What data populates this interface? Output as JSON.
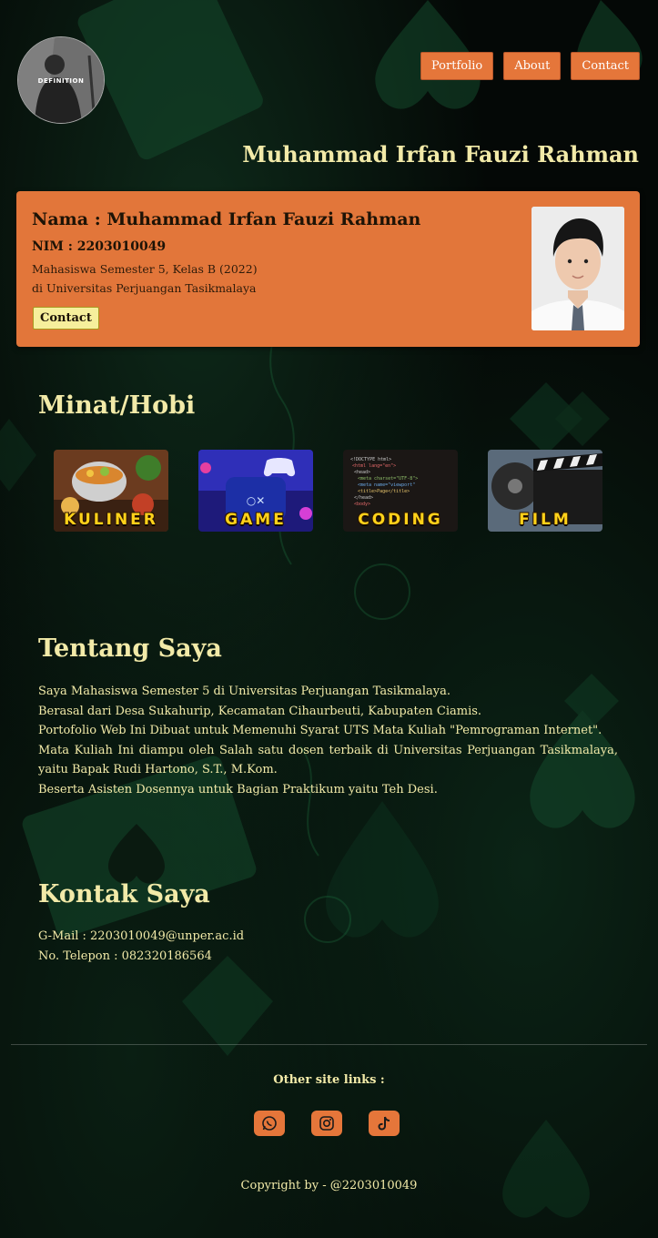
{
  "header": {
    "avatar_text": "DEFINITION",
    "nav": [
      {
        "label": "Portfolio"
      },
      {
        "label": "About"
      },
      {
        "label": "Contact"
      }
    ],
    "site_title": "Muhammad Irfan Fauzi Rahman"
  },
  "profile": {
    "name": "Nama : Muhammad Irfan Fauzi Rahman",
    "nim": "NIM : 2203010049",
    "desc_line1": "Mahasiswa Semester 5, Kelas B (2022)",
    "desc_line2": "di Universitas Perjuangan Tasikmalaya",
    "contact_label": "Contact"
  },
  "hobbies": {
    "title": "Minat/Hobi",
    "items": [
      {
        "label": "KULINER"
      },
      {
        "label": "GAME"
      },
      {
        "label": "CODING"
      },
      {
        "label": "FILM"
      }
    ]
  },
  "about": {
    "title": "Tentang Saya",
    "lines": [
      "Saya Mahasiswa Semester 5 di Universitas Perjuangan Tasikmalaya.",
      "Berasal dari Desa Sukahurip, Kecamatan Cihaurbeuti, Kabupaten Ciamis.",
      "Portofolio Web Ini Dibuat untuk Memenuhi Syarat UTS Mata Kuliah \"Pemrograman Internet\".",
      "Mata Kuliah Ini diampu oleh Salah satu dosen terbaik di Universitas Perjuangan Tasikmalaya, yaitu Bapak Rudi Hartono, S.T., M.Kom.",
      "Beserta Asisten Dosennya untuk Bagian Praktikum yaitu Teh Desi."
    ]
  },
  "contact": {
    "title": "Kontak Saya",
    "email": "G-Mail : 2203010049@unper.ac.id",
    "phone": "No. Telepon : 082320186564"
  },
  "footer": {
    "other_links": "Other site links :",
    "socials": [
      {
        "icon": "whatsapp-icon"
      },
      {
        "icon": "instagram-icon"
      },
      {
        "icon": "tiktok-icon"
      }
    ],
    "copyright": "Copyright by - @2203010049"
  },
  "colors": {
    "accent": "#e5763a",
    "text": "#f2eaa8",
    "background": "#040806"
  }
}
